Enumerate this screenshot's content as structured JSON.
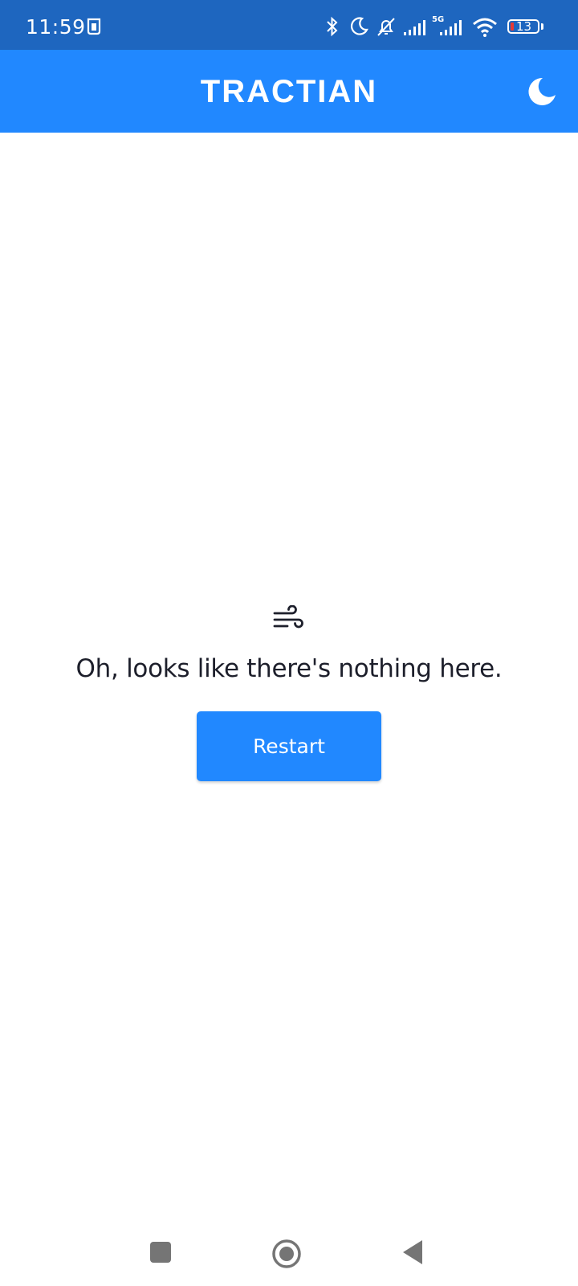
{
  "status_bar": {
    "time": "11:59",
    "network": "5G",
    "battery_level": "13",
    "icons": [
      "clipboard-icon",
      "bluetooth-icon",
      "moon-icon",
      "bell-off-icon",
      "signal-icon",
      "wifi-icon",
      "battery-icon"
    ]
  },
  "app_bar": {
    "logo": "TRACTIAN",
    "theme_toggle_icon": "moon-icon"
  },
  "empty_state": {
    "icon": "wind-icon",
    "message": "Oh, looks like there's nothing here.",
    "button_label": "Restart"
  },
  "nav_bar": {
    "icons": [
      "recent-apps-icon",
      "home-icon",
      "back-icon"
    ]
  },
  "colors": {
    "status_bar": "#1e66bf",
    "primary": "#2188ff",
    "text": "#1d1f2b",
    "nav_icon": "#757575",
    "battery_low": "#e53935"
  }
}
